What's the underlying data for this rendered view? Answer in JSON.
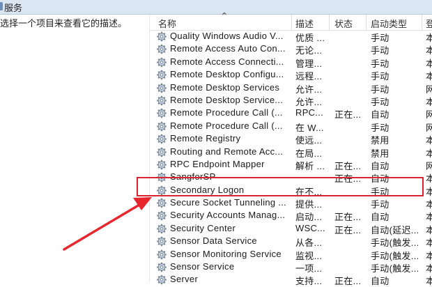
{
  "window": {
    "title": "服务"
  },
  "left_pane": {
    "description": "选择一个项目来查看它的描述。"
  },
  "columns": {
    "name": "名称",
    "description": "描述",
    "status": "状态",
    "startup": "启动类型",
    "logon": "登"
  },
  "services": [
    {
      "name": "Quality Windows Audio V...",
      "desc": "优质 ...",
      "status": "",
      "startup": "手动",
      "logon": "本"
    },
    {
      "name": "Remote Access Auto Con...",
      "desc": "无论...",
      "status": "",
      "startup": "手动",
      "logon": "本"
    },
    {
      "name": "Remote Access Connecti...",
      "desc": "管理...",
      "status": "",
      "startup": "手动",
      "logon": "本"
    },
    {
      "name": "Remote Desktop Configu...",
      "desc": "远程...",
      "status": "",
      "startup": "手动",
      "logon": "本"
    },
    {
      "name": "Remote Desktop Services",
      "desc": "允许...",
      "status": "",
      "startup": "手动",
      "logon": "网"
    },
    {
      "name": "Remote Desktop Service...",
      "desc": "允许...",
      "status": "",
      "startup": "手动",
      "logon": "本"
    },
    {
      "name": "Remote Procedure Call (...",
      "desc": "RPC...",
      "status": "正在...",
      "startup": "自动",
      "logon": "网"
    },
    {
      "name": "Remote Procedure Call (...",
      "desc": "在 W...",
      "status": "",
      "startup": "手动",
      "logon": "网"
    },
    {
      "name": "Remote Registry",
      "desc": "使远...",
      "status": "",
      "startup": "禁用",
      "logon": "本"
    },
    {
      "name": "Routing and Remote Acc...",
      "desc": "在局...",
      "status": "",
      "startup": "禁用",
      "logon": "本"
    },
    {
      "name": "RPC Endpoint Mapper",
      "desc": "解析 ...",
      "status": "正在...",
      "startup": "自动",
      "logon": "网"
    },
    {
      "name": "SangforSP",
      "desc": "",
      "status": "正在...",
      "startup": "自动",
      "logon": "本"
    },
    {
      "name": "Secondary Logon",
      "desc": "在不...",
      "status": "",
      "startup": "手动",
      "logon": "本"
    },
    {
      "name": "Secure Socket Tunneling ...",
      "desc": "提供...",
      "status": "",
      "startup": "手动",
      "logon": "本"
    },
    {
      "name": "Security Accounts Manag...",
      "desc": "启动...",
      "status": "正在...",
      "startup": "自动",
      "logon": "本"
    },
    {
      "name": "Security Center",
      "desc": "WSC...",
      "status": "正在...",
      "startup": "自动(延迟...",
      "logon": "本"
    },
    {
      "name": "Sensor Data Service",
      "desc": "从各...",
      "status": "",
      "startup": "手动(触发...",
      "logon": "本"
    },
    {
      "name": "Sensor Monitoring Service",
      "desc": "监视...",
      "status": "",
      "startup": "手动(触发...",
      "logon": "本"
    },
    {
      "name": "Sensor Service",
      "desc": "一项...",
      "status": "",
      "startup": "手动(触发...",
      "logon": "本"
    },
    {
      "name": "Server",
      "desc": "支持...",
      "status": "正在...",
      "startup": "自动",
      "logon": "本"
    }
  ],
  "annotation": {
    "highlight_color": "#d9232e",
    "arrow_color": "#e8262e"
  },
  "icon": "gear-icon"
}
